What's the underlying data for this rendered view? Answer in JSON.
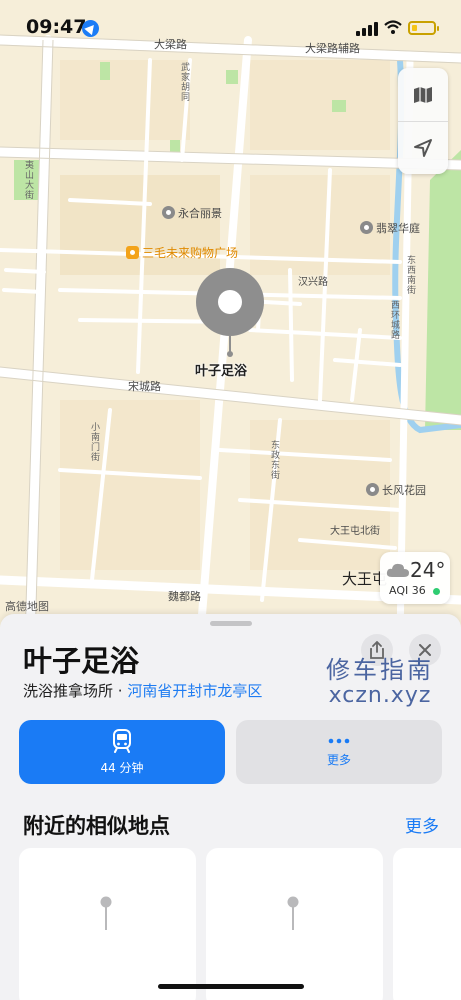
{
  "status_bar": {
    "time": "09:47"
  },
  "map": {
    "labels": {
      "daliang_road": "大梁路",
      "daliang_road_aux": "大梁路辅路",
      "yongheli": "永合丽景",
      "cuihuating": "翡翠华庭",
      "sanmao_mall": "三毛未来购物广场",
      "hanxing_road": "汉兴路",
      "songcheng_road": "宋城路",
      "changfeng_garden": "长风花园",
      "dawangtun_north": "大王屯北街",
      "dawangtun": "大王屯",
      "weidu_road": "魏都路",
      "huangshan_street": "夷山大街",
      "wujiao_street": "武家胡同",
      "dongxi_street": "东西南街",
      "xihuan_street": "西环城路",
      "dongshi_street": "东政东街",
      "xiaoshao_street": "小南门街"
    },
    "pin_label": "叶子足浴",
    "weather": {
      "temp": "24°",
      "aqi": "AQI 36"
    },
    "brand": "高德地图",
    "colors": {
      "land": "#f6eed9",
      "road": "#ffffff",
      "park": "#bde5a5",
      "water": "#9fd0ef",
      "pin": "#8e8e8e"
    }
  },
  "place": {
    "name": "叶子足浴",
    "category": "洗浴推拿场所",
    "separator": " · ",
    "region": "河南省开封市龙亭区"
  },
  "watermark": {
    "line1": "修车指南",
    "line2": "xczn.xyz"
  },
  "actions": {
    "transit_label": "44 分钟",
    "more_label": "更多"
  },
  "nearby": {
    "title": "附近的相似地点",
    "more": "更多"
  },
  "colors": {
    "accent": "#1a7bf5",
    "sheet_bg": "#f2f2f4"
  }
}
